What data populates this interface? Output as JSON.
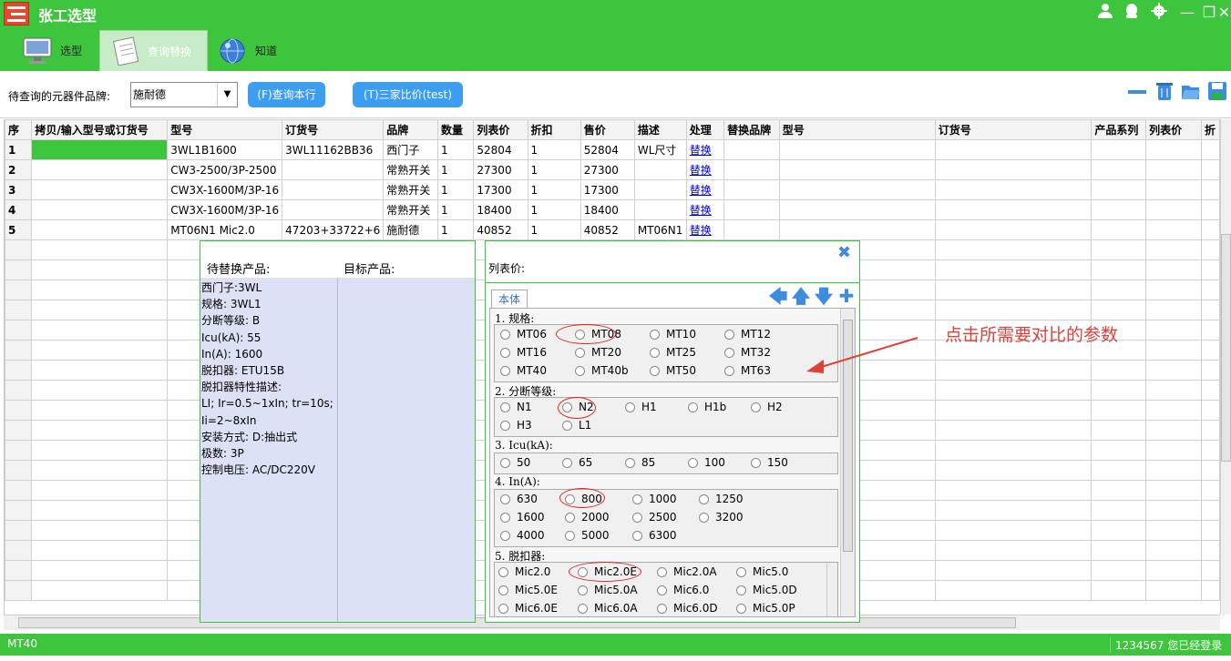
{
  "app": {
    "title": "张工选型"
  },
  "window_controls": {
    "user_icon": "user-icon",
    "qq_icon": "qq-icon",
    "settings_icon": "gear-icon",
    "minimize": "—",
    "restore": "❐",
    "close": "✕"
  },
  "tabs": [
    {
      "label": "选型",
      "icon": "monitor-icon"
    },
    {
      "label": "查询替换",
      "icon": "notepad-icon"
    },
    {
      "label": "知道",
      "icon": "globe-icon"
    }
  ],
  "search": {
    "brand_label": "待查询的元器件品牌:",
    "brand_value": "施耐德",
    "query_btn": "(F)查询本行",
    "compare_btn": "(T)三家比价(test)"
  },
  "grid": {
    "columns": [
      "序",
      "拷贝/输入型号或订货号",
      "型号",
      "订货号",
      "品牌",
      "数量",
      "列表价",
      "折扣",
      "售价",
      "描述",
      "处理",
      "替换品牌",
      "型号",
      "订货号",
      "产品系列",
      "列表价",
      "折"
    ],
    "rows": [
      [
        "1",
        "",
        "3WL1B1600",
        "3WL11162BB36",
        "西门子",
        "1",
        "52804",
        "1",
        "52804",
        "WL尺寸",
        "替换",
        "",
        "",
        "",
        "",
        "",
        ""
      ],
      [
        "2",
        "",
        "CW3-2500/3P-2500",
        "",
        "常熟开关",
        "1",
        "27300",
        "1",
        "27300",
        "",
        "替换",
        "",
        "",
        "",
        "",
        "",
        ""
      ],
      [
        "3",
        "",
        "CW3X-1600M/3P-16",
        "",
        "常熟开关",
        "1",
        "17300",
        "1",
        "17300",
        "",
        "替换",
        "",
        "",
        "",
        "",
        "",
        ""
      ],
      [
        "4",
        "",
        "CW3X-1600M/3P-16",
        "",
        "常熟开关",
        "1",
        "18400",
        "1",
        "18400",
        "",
        "替换",
        "",
        "",
        "",
        "",
        "",
        ""
      ],
      [
        "5",
        "",
        "MT06N1 Mic2.0",
        "47203+33722+6",
        "施耐德",
        "1",
        "40852",
        "1",
        "40852",
        "MT06N1",
        "替换",
        "",
        "",
        "",
        "",
        "",
        ""
      ]
    ]
  },
  "left_panel": {
    "header_pending": "待替换产品:",
    "header_target": "目标产品:",
    "lines": [
      "西门子:3WL",
      "规格: 3WL1",
      "分断等级: B",
      "Icu(kA): 55",
      "In(A): 1600",
      "脱扣器: ETU15B",
      "脱扣器特性描述:",
      "LI; Ir=0.5~1xIn; tr=10s;",
      "Ii=2~8xIn",
      "安装方式: D:抽出式",
      "极数: 3P",
      "控制电压: AC/DC220V"
    ]
  },
  "right_panel": {
    "title": "列表价:",
    "tab": "本体",
    "sections": [
      {
        "title": "1. 规格:",
        "options": [
          "MT06",
          "MT08",
          "MT10",
          "MT12",
          "MT16",
          "MT20",
          "MT25",
          "MT32",
          "MT40",
          "MT40b",
          "MT50",
          "MT63"
        ]
      },
      {
        "title": "2. 分断等级:",
        "options": [
          "N1",
          "N2",
          "H1",
          "H1b",
          "H2",
          "H3",
          "L1"
        ]
      },
      {
        "title": "3. Icu(kA):",
        "options": [
          "50",
          "65",
          "85",
          "100",
          "150"
        ]
      },
      {
        "title": "4. In(A):",
        "options": [
          "630",
          "800",
          "1000",
          "1250",
          "1600",
          "2000",
          "2500",
          "3200",
          "4000",
          "5000",
          "6300"
        ]
      },
      {
        "title": "5. 脱扣器:",
        "options": [
          "Mic2.0",
          "Mic2.0E",
          "Mic2.0A",
          "Mic5.0",
          "Mic5.0E",
          "Mic5.0A",
          "Mic6.0",
          "Mic5.0D",
          "Mic6.0E",
          "Mic6.0A",
          "Mic6.0D",
          "Mic5.0P"
        ]
      }
    ]
  },
  "annotation": {
    "text": "点击所需要对比的参数"
  },
  "status": {
    "left": "MT40",
    "right": "1234567 您已经登录"
  },
  "colors": {
    "accent": "#3ec53e",
    "button": "#3d9df0",
    "annotation": "#e0403a"
  }
}
